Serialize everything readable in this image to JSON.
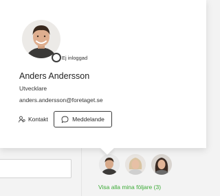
{
  "profile": {
    "name": "Anders Andersson",
    "role": "Utvecklare",
    "email": "anders.andersson@foretaget.se",
    "status": "Ej inloggad",
    "avatar_icon": "user-photo"
  },
  "actions": {
    "contact_label": "Kontakt",
    "contact_icon": "contact-person-icon",
    "message_label": "Meddelande",
    "message_icon": "chat-bubble-icon"
  },
  "followers": {
    "link_label": "Visa alla mina följare (3)",
    "link_color": "#3aaa35",
    "avatars": [
      "follower-avatar-1",
      "follower-avatar-2",
      "follower-avatar-3"
    ]
  },
  "search": {
    "placeholder": ""
  }
}
